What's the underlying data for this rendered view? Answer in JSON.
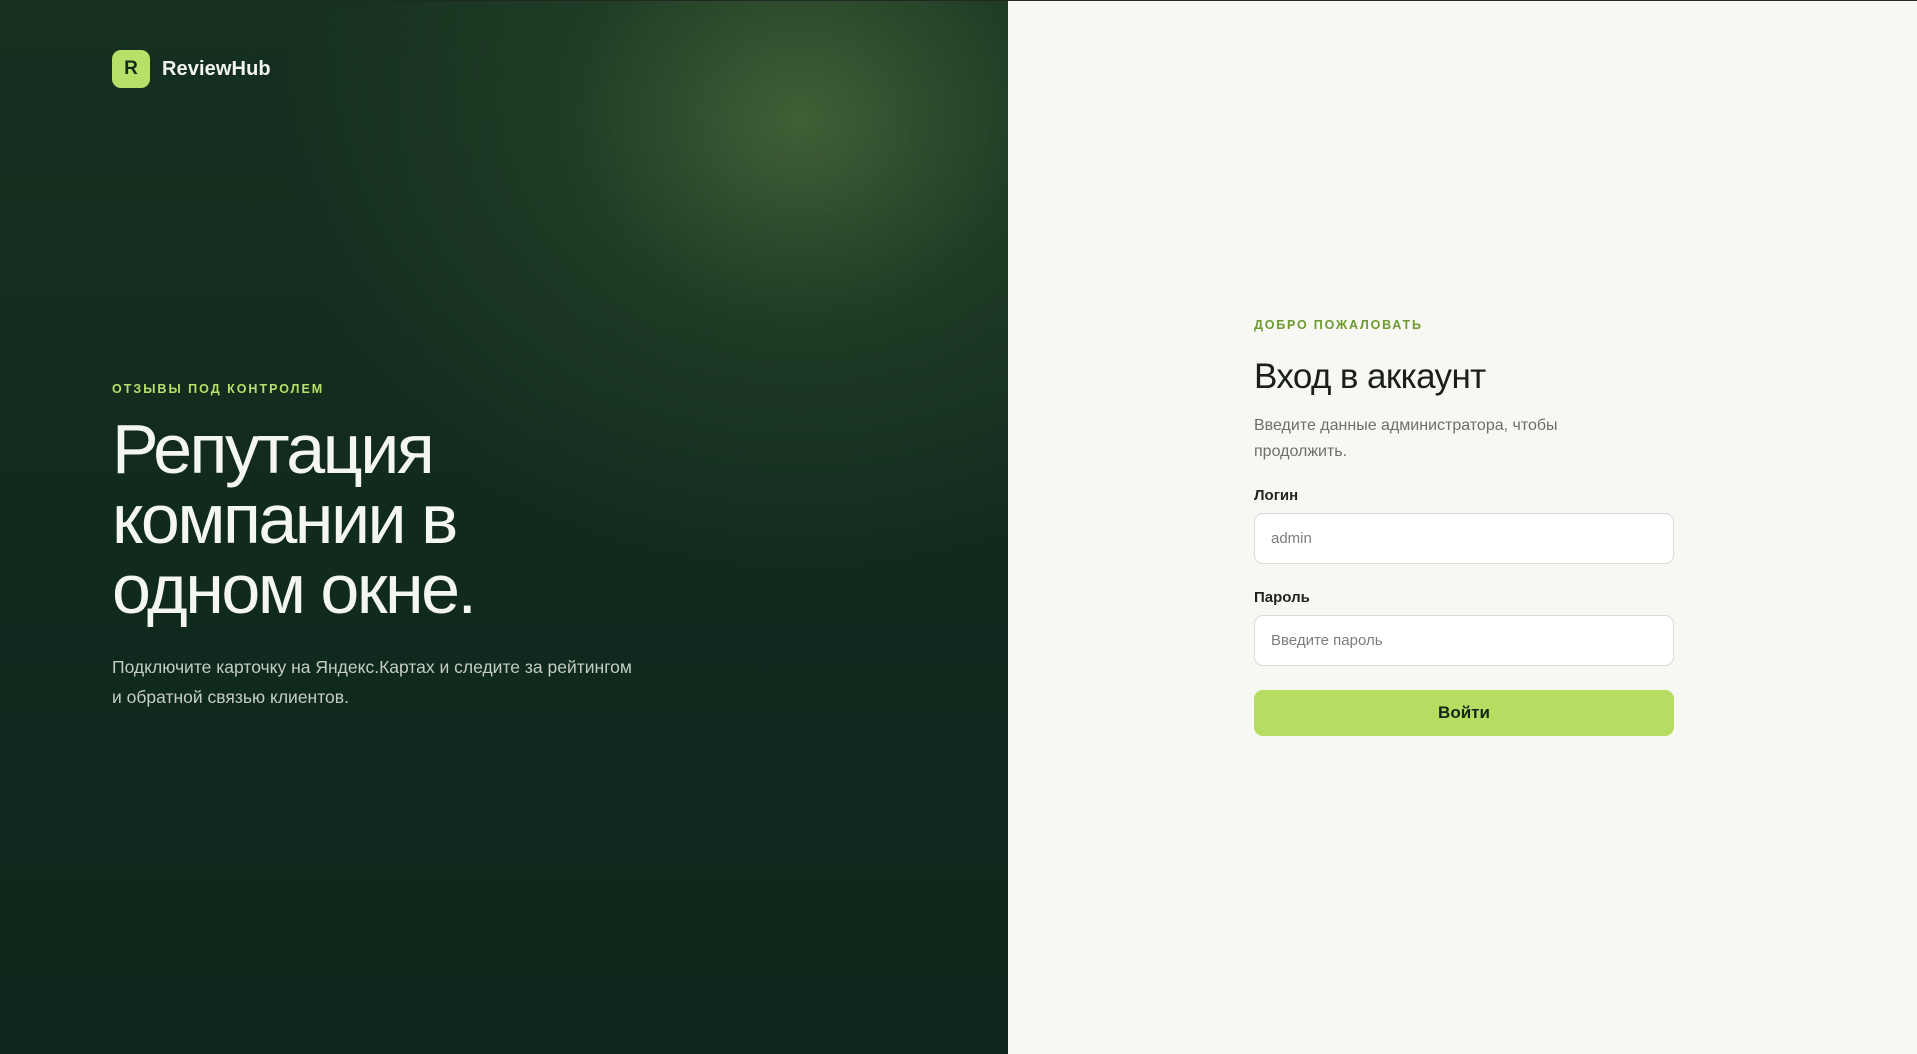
{
  "brand": {
    "logo_letter": "R",
    "name": "ReviewHub"
  },
  "hero": {
    "kicker": "ОТЗЫВЫ ПОД КОНТРОЛЕМ",
    "title": "Репутация компании в одном окне.",
    "subtitle": "Подключите карточку на Яндекс.Картах и следите за рейтингом и обратной связью клиентов."
  },
  "login": {
    "kicker": "ДОБРО ПОЖАЛОВАТЬ",
    "title": "Вход в аккаунт",
    "description": "Введите данные администратора, чтобы продолжить.",
    "username_label": "Логин",
    "username_placeholder": "admin",
    "password_label": "Пароль",
    "password_placeholder": "Введите пароль",
    "submit_label": "Войти"
  },
  "colors": {
    "accent": "#b7dc62",
    "hero_bg": "#112a1e",
    "form_bg": "#f7f7f3",
    "kicker_green": "#6e9a2e"
  }
}
